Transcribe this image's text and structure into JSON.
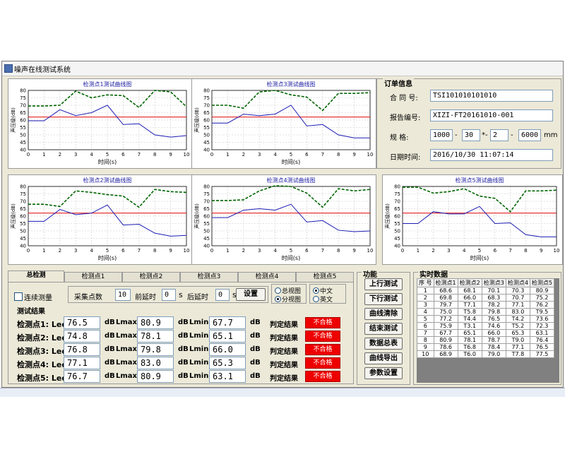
{
  "window": {
    "title": "噪声在线测试系统"
  },
  "charts": [
    {
      "title": "检测点1测试曲线图",
      "upper": [
        69.5,
        69.5,
        70.0,
        79.5,
        75.0,
        77.0,
        76.5,
        68.5,
        80.0,
        79.0,
        69.0
      ],
      "lower": [
        59.5,
        59.5,
        67.0,
        63.0,
        65.0,
        70.0,
        57.0,
        57.5,
        50.0,
        48.5,
        49.5
      ]
    },
    {
      "title": "检测点3测试曲线图",
      "upper": [
        70.0,
        70.0,
        68.0,
        79.0,
        80.0,
        77.0,
        75.5,
        66.5,
        78.0,
        78.0,
        78.5
      ],
      "lower": [
        58.0,
        58.0,
        64.0,
        63.0,
        64.0,
        70.0,
        56.0,
        57.0,
        50.0,
        48.0,
        48.0
      ]
    },
    {
      "title": "检测点2测试曲线图",
      "upper": [
        68.0,
        68.0,
        66.5,
        77.0,
        76.0,
        74.5,
        73.5,
        66.0,
        78.0,
        76.5,
        76.0
      ],
      "lower": [
        56.5,
        56.5,
        64.5,
        61.0,
        62.0,
        67.5,
        54.0,
        54.5,
        48.5,
        46.5,
        47.0
      ]
    },
    {
      "title": "检测点4测试曲线图",
      "upper": [
        70.5,
        70.5,
        71.0,
        77.0,
        80.5,
        80.0,
        75.5,
        66.0,
        78.5,
        77.0,
        78.0
      ],
      "lower": [
        59.0,
        59.0,
        64.0,
        65.0,
        64.0,
        68.0,
        56.0,
        57.0,
        50.5,
        49.5,
        50.0
      ]
    },
    {
      "title": "检测点5测试曲线图",
      "upper": [
        79.5,
        79.5,
        75.5,
        76.5,
        78.5,
        73.5,
        72.0,
        63.0,
        77.0,
        77.0,
        77.5
      ],
      "lower": [
        55.0,
        55.0,
        63.0,
        61.5,
        61.5,
        66.5,
        55.0,
        55.5,
        47.5,
        46.0,
        46.0
      ]
    }
  ],
  "chart_axis": {
    "xlabel": "时间(s)",
    "ylabel": "声压级(dB)",
    "xticks": [
      "0",
      "1",
      "2",
      "3",
      "4",
      "5",
      "6",
      "7",
      "8",
      "9",
      "10"
    ],
    "yticks": [
      "40",
      "45",
      "50",
      "55",
      "60",
      "65",
      "70",
      "75",
      "80"
    ],
    "limit": 62,
    "upper_color": "#006400",
    "lower_color": "#1c1cb4",
    "limit_color": "#e00000"
  },
  "order": {
    "title": "订单信息",
    "contract_label": "合 同 号:",
    "contract_value": "TSI101010101010",
    "report_label": "报告编号:",
    "report_value": "XIZI-FT20161010-001",
    "spec_label": "规    格:",
    "spec": [
      "1000",
      "30",
      "2",
      "6000"
    ],
    "spec_seps": [
      "-",
      "*-",
      "-"
    ],
    "spec_unit": "mm",
    "date_label": "日期时间:",
    "date_value": "2016/10/30    11:07:14"
  },
  "tabs": [
    "总检测",
    "检测点1",
    "检测点2",
    "检测点3",
    "检测点4",
    "检测点5"
  ],
  "controls": {
    "continuous_label": "连续测量",
    "sample_label": "采集点数",
    "sample_value": "10",
    "pre_delay_label": "前延时",
    "pre_delay_value": "0",
    "s1": "s",
    "post_delay_label": "后延时",
    "post_delay_value": "0",
    "s2": "s",
    "set_button": "设置",
    "view_total": "总视图",
    "view_split": "分视图",
    "lang_cn": "中文",
    "lang_en": "英文"
  },
  "results": {
    "title": "测试结果",
    "rows": [
      {
        "label": "检测点1: Leq",
        "leq": "76.5",
        "lmax": "80.9",
        "lmin": "67.7",
        "verdict": "不合格"
      },
      {
        "label": "检测点2: Leq",
        "leq": "74.8",
        "lmax": "78.1",
        "lmin": "65.1",
        "verdict": "不合格"
      },
      {
        "label": "检测点3: Leq",
        "leq": "76.8",
        "lmax": "79.8",
        "lmin": "66.0",
        "verdict": "不合格"
      },
      {
        "label": "检测点4: Leq",
        "leq": "77.1",
        "lmax": "83.0",
        "lmin": "65.3",
        "verdict": "不合格"
      },
      {
        "label": "检测点5: Leq",
        "leq": "76.7",
        "lmax": "80.9",
        "lmin": "63.1",
        "verdict": "不合格"
      }
    ],
    "unit": "dB",
    "lmax_label": "Lmax",
    "lmin_label": "Lmin",
    "judge_label": "判定结果"
  },
  "functions": {
    "title": "功能",
    "buttons": [
      "上行测试",
      "下行测试",
      "曲线清除",
      "结束测试",
      "数据总表",
      "曲线导出",
      "参数设置"
    ]
  },
  "realtime": {
    "title": "实时数据",
    "headers": [
      "序 号",
      "检测点1",
      "检测点2",
      "检测点3",
      "检测点4",
      "检测点5"
    ],
    "rows": [
      [
        "1",
        "68.6",
        "68.1",
        "70.1",
        "70.3",
        "80.9"
      ],
      [
        "2",
        "69.8",
        "66.0",
        "68.3",
        "70.7",
        "75.2"
      ],
      [
        "3",
        "79.7",
        "T7.1",
        "78.2",
        "77.1",
        "76.2"
      ],
      [
        "4",
        "75.0",
        "T5.8",
        "79.8",
        "83.0",
        "T9.5"
      ],
      [
        "5",
        "77.2",
        "T4.4",
        "76.5",
        "T4.2",
        "73.6"
      ],
      [
        "6",
        "75.9",
        "T3.1",
        "74.6",
        "T5.2",
        "72.3"
      ],
      [
        "7",
        "67.7",
        "65.1",
        "66.0",
        "65.3",
        "63.1"
      ],
      [
        "8",
        "80.9",
        "78.1",
        "78.7",
        "T9.0",
        "76.4"
      ],
      [
        "9",
        "78.6",
        "T6.8",
        "78.4",
        "77.1",
        "76.5"
      ],
      [
        "10",
        "68.9",
        "T6.0",
        "79.0",
        "T7.8",
        "77.5"
      ]
    ]
  }
}
